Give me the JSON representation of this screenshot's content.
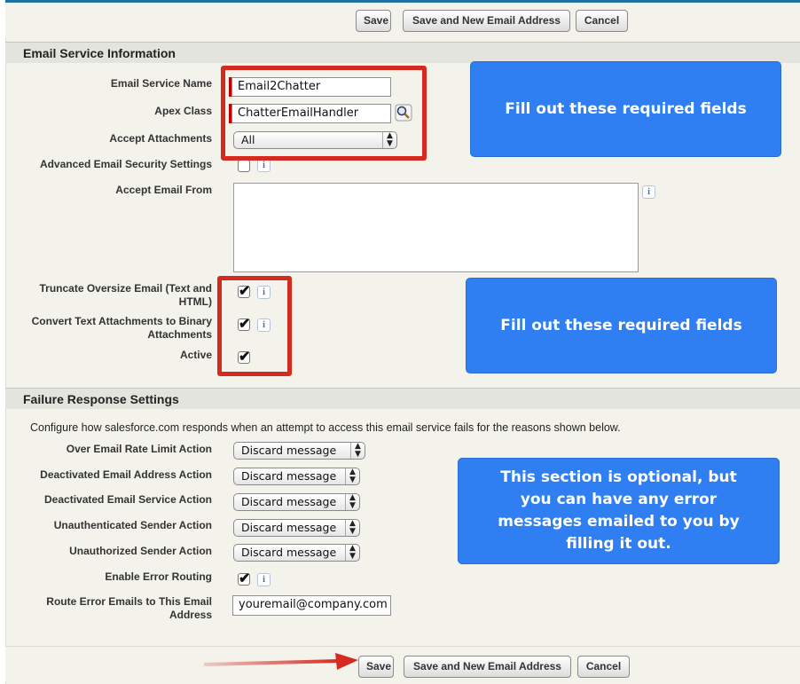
{
  "buttons": {
    "save": "Save",
    "save_new": "Save and New Email Address",
    "cancel": "Cancel"
  },
  "email_service": {
    "header": "Email Service Information",
    "name_label": "Email Service Name",
    "name_value": "Email2Chatter",
    "apex_label": "Apex Class",
    "apex_value": "ChatterEmailHandler",
    "attachments_label": "Accept Attachments",
    "attachments_value": "All",
    "security_label": "Advanced Email Security Settings",
    "accept_from_label": "Accept Email From",
    "truncate_label_1": "Truncate Oversize Email (Text and",
    "truncate_label_2": "HTML)",
    "convert_label_1": "Convert Text Attachments to Binary",
    "convert_label_2": "Attachments",
    "active_label": "Active",
    "info_icon": "i"
  },
  "failure": {
    "header": "Failure Response Settings",
    "description": "Configure how salesforce.com responds when an attempt to access this email service fails for the reasons shown below.",
    "rows": [
      {
        "label": "Over Email Rate Limit Action",
        "value": "Discard message"
      },
      {
        "label": "Deactivated Email Address Action",
        "value": "Discard message"
      },
      {
        "label": "Deactivated Email Service Action",
        "value": "Discard message"
      },
      {
        "label": "Unauthenticated Sender Action",
        "value": "Discard message"
      },
      {
        "label": "Unauthorized Sender Action",
        "value": "Discard message"
      }
    ],
    "error_routing_label": "Enable Error Routing",
    "route_label_1": "Route Error Emails to This Email",
    "route_label_2": "Address",
    "route_value": "youremail@company.com"
  },
  "callouts": {
    "first": "Fill out these required fields",
    "second": "Fill out these required fields",
    "third": "This section is optional, but you can have any error messages emailed to you by filling it out."
  },
  "checkmark": "✔",
  "select_arrows": "▲▼"
}
